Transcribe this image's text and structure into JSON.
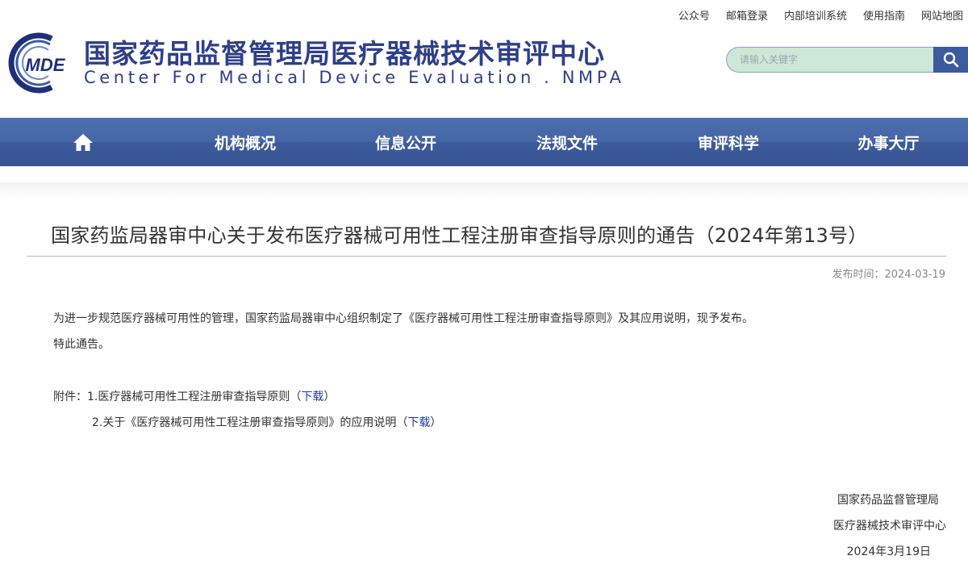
{
  "toplinks": [
    "公众号",
    "邮箱登录",
    "内部培训系统",
    "使用指南",
    "网站地图"
  ],
  "header": {
    "logo_text": "MDE",
    "title": "国家药品监督管理局医疗器械技术审评中心",
    "subtitle": "Center For Medical Device Evaluation . NMPA"
  },
  "search": {
    "placeholder": "请输入关键字"
  },
  "nav": {
    "home_icon": "home-icon",
    "items": [
      "机构概况",
      "信息公开",
      "法规文件",
      "审评科学",
      "办事大厅"
    ]
  },
  "article": {
    "title": "国家药监局器审中心关于发布医疗器械可用性工程注册审查指导原则的通告（2024年第13号）",
    "pubdate": "发布时间：2024-03-19",
    "paragraph1": "为进一步规范医疗器械可用性的管理，国家药监局器审中心组织制定了《医疗器械可用性工程注册审查指导原则》及其应用说明，现予发布。",
    "paragraph2": "特此通告。",
    "attachments_label": "附件：",
    "attachments": [
      {
        "text": "1.医疗器械可用性工程注册审查指导原则（",
        "link": "下载",
        "close": "）"
      },
      {
        "text": "2.关于《医疗器械可用性工程注册审查指导原则》的应用说明（",
        "link": "下载",
        "close": "）"
      }
    ],
    "signature": [
      "国家药品监督管理局",
      "医疗器械技术审评中心",
      "2024年3月19日"
    ]
  },
  "colors": {
    "brand": "#2e3f8a",
    "nav": "#4466a6",
    "search_bg": "#cde8d6",
    "link": "#1a3b9e"
  }
}
